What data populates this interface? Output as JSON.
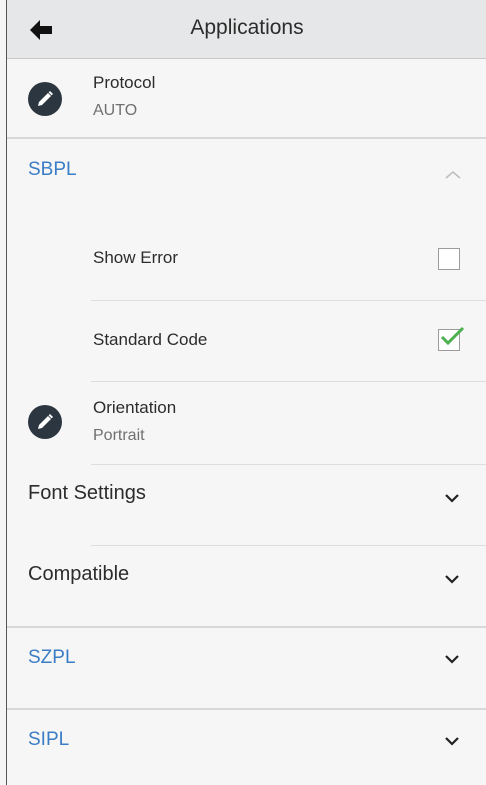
{
  "header": {
    "title": "Applications",
    "back_icon": "back-arrow-icon"
  },
  "protocol": {
    "label": "Protocol",
    "value": "AUTO",
    "icon": "pencil-icon"
  },
  "sbpl": {
    "title": "SBPL",
    "expanded": true,
    "show_error": {
      "label": "Show Error",
      "checked": false
    },
    "standard_code": {
      "label": "Standard Code",
      "checked": true
    },
    "orientation": {
      "label": "Orientation",
      "value": "Portrait",
      "icon": "pencil-icon"
    },
    "font_settings": {
      "label": "Font Settings"
    },
    "compatible": {
      "label": "Compatible"
    }
  },
  "szpl": {
    "title": "SZPL"
  },
  "sipl": {
    "title": "SIPL"
  },
  "colors": {
    "accent": "#3a7dc5",
    "check": "#4caf50",
    "header_bg": "#e6e7e8",
    "icon_bg": "#2b3640"
  }
}
